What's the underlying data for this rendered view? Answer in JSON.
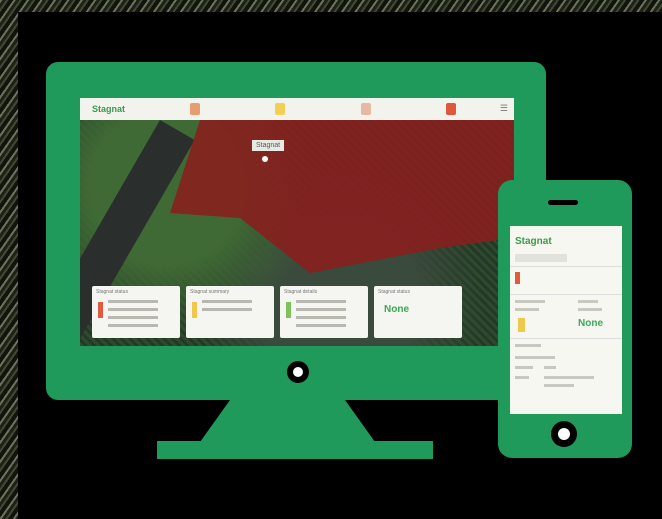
{
  "desktop_app": {
    "logo": "Stagnat",
    "map_label": "Stagnat",
    "cards": [
      {
        "title": "Stagnat status",
        "accent": "#e05a3d"
      },
      {
        "title": "Stagnat summary",
        "accent": "#f1c84e"
      },
      {
        "title": "Stagnat details",
        "accent": "#7cc35b"
      },
      {
        "title": "Stagnat status",
        "value": "None"
      }
    ]
  },
  "mobile_app": {
    "logo": "Stagnat",
    "value": "None"
  },
  "colors": {
    "device_green": "#1f9a5b",
    "polygon_red": "#8a1e1e",
    "accent_green": "#3da856"
  }
}
